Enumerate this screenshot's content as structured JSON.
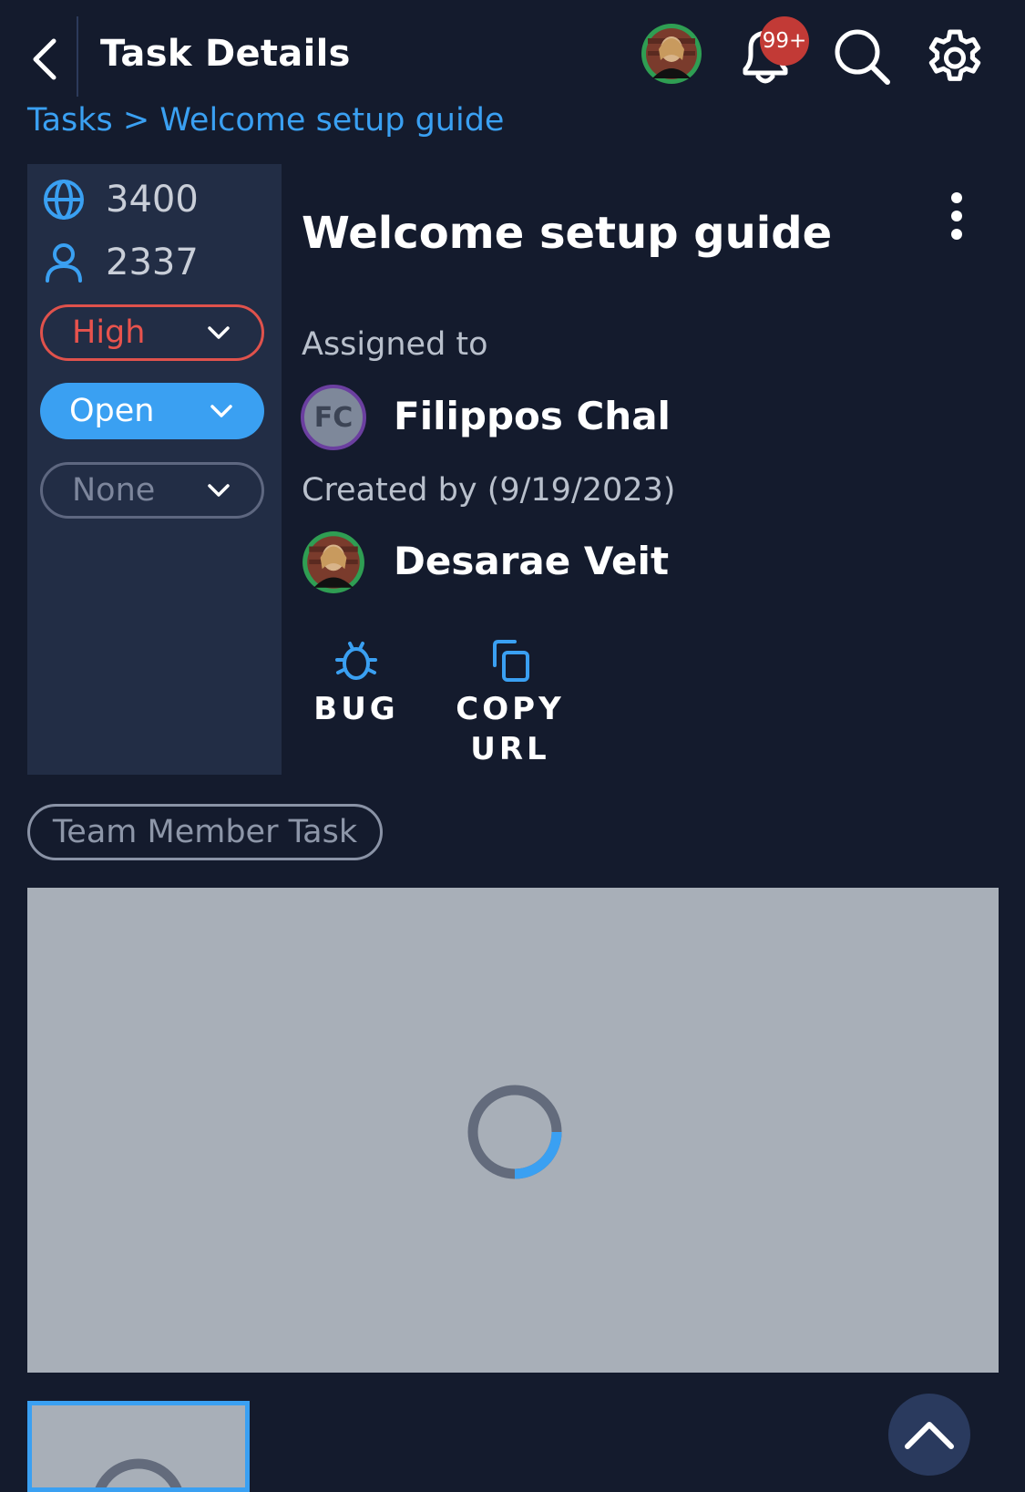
{
  "header": {
    "title": "Task Details",
    "notification_badge": "99+"
  },
  "breadcrumb": {
    "text": "Tasks > Welcome setup guide"
  },
  "sidebar": {
    "stats": [
      {
        "icon": "globe-icon",
        "value": "3400"
      },
      {
        "icon": "user-icon",
        "value": "2337"
      }
    ],
    "priority": "High",
    "status": "Open",
    "category": "None"
  },
  "task": {
    "title": "Welcome setup guide",
    "assigned_label": "Assigned to",
    "assignee_initials": "FC",
    "assignee_name": "Filippos Chal",
    "created_label": "Created by (9/19/2023)",
    "creator_name": "Desarae Veit"
  },
  "actions": {
    "bug_label": "BUG",
    "copy_url_label": "COPY URL"
  },
  "tag": "Team Member Task",
  "colors": {
    "background": "#141b2d",
    "panel": "#222d45",
    "accent_blue": "#3aa0f2",
    "priority_red": "#e8534d",
    "badge_red": "#c23a36"
  }
}
